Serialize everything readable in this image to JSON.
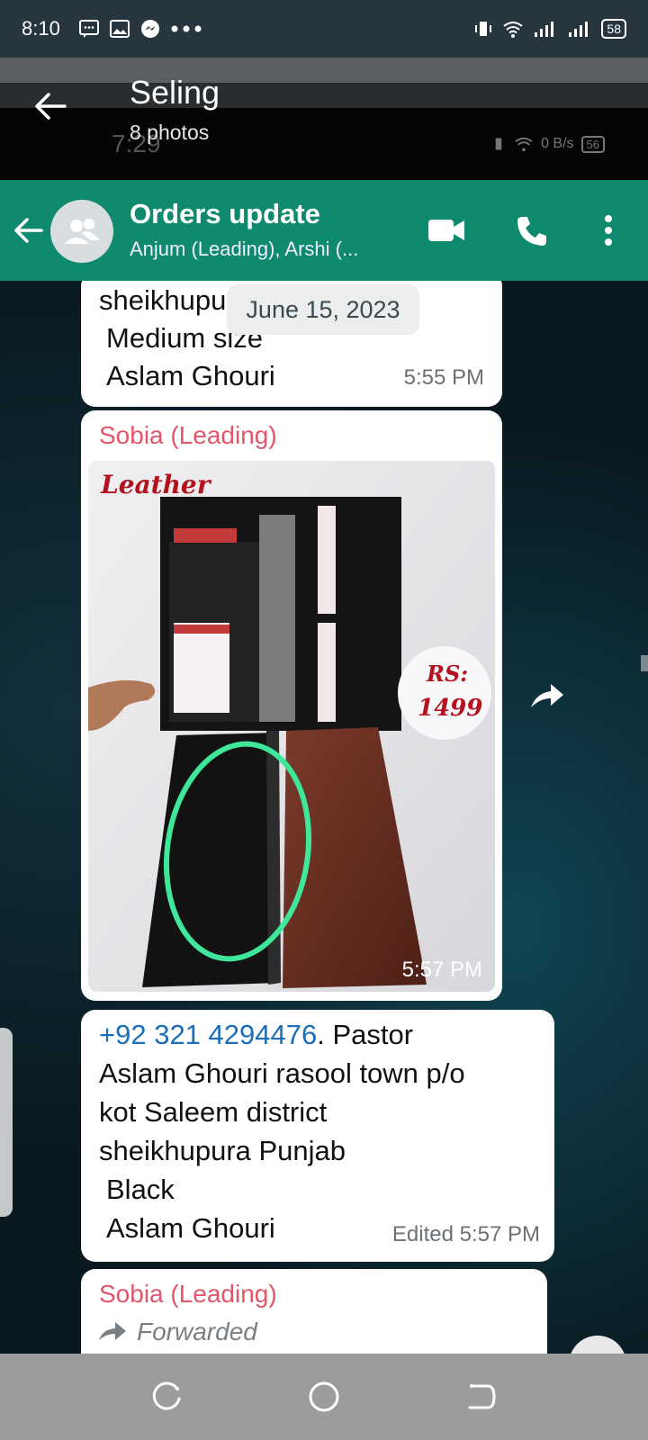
{
  "status_bar": {
    "time": "8:10",
    "left_icons": [
      "message-icon",
      "image-icon",
      "messenger-icon",
      "more-dots-icon"
    ],
    "right_icons": [
      "vibrate-icon",
      "wifi-icon",
      "signal-icon",
      "signal-icon"
    ],
    "battery": "58"
  },
  "viewer": {
    "title": "Seling",
    "subtitle": "8 photos",
    "ghost_time": "7:29",
    "ghost_speed": "0 B/s",
    "ghost_battery": "56"
  },
  "chat_header": {
    "title": "Orders update",
    "subtitle": "Anjum (Leading), Arshi (...",
    "accent_color": "#0f8a6f"
  },
  "messages": {
    "first": {
      "lines": [
        "sheikhupura Punjab",
        "Medium size",
        "Aslam Ghouri"
      ],
      "time": "5:55 PM"
    },
    "date_chip": "June 15, 2023",
    "photo_msg": {
      "sender": "Sobia (Leading)",
      "photo_label": "Leather",
      "price_label_1": "RS:",
      "price_label_2": "1499",
      "time": "5:57 PM"
    },
    "text_msg": {
      "phone": "+92 321 4294476",
      "line1_rest": ".  Pastor",
      "line2": "Aslam Ghouri rasool town p/o",
      "line3": "kot Saleem district",
      "line4": "sheikhupura Punjab",
      "line5": "Black",
      "line6": "Aslam Ghouri",
      "time": "Edited 5:57 PM"
    },
    "last_msg": {
      "sender": "Sobia (Leading)",
      "forwarded": "Forwarded"
    }
  },
  "sender_color": "#e2566a",
  "link_color": "#1a6fb8",
  "nav": [
    "recents-button",
    "home-button",
    "back-button"
  ]
}
